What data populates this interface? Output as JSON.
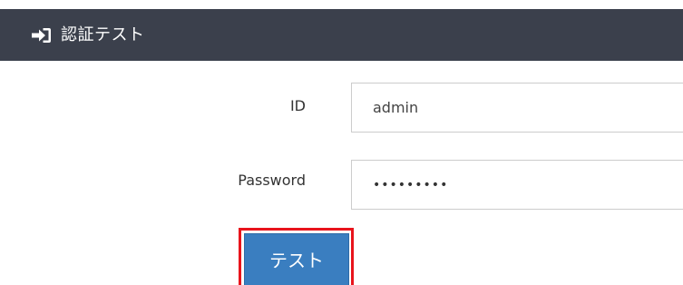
{
  "header": {
    "title": "認証テスト",
    "icon": "sign-in-icon"
  },
  "form": {
    "id_label": "ID",
    "id_value": "admin",
    "password_label": "Password",
    "password_mask": "•••••••••"
  },
  "actions": {
    "test_label": "テスト"
  },
  "colors": {
    "header_bg": "#3b404c",
    "button_bg": "#3a7ec0",
    "highlight": "#e8141c"
  }
}
